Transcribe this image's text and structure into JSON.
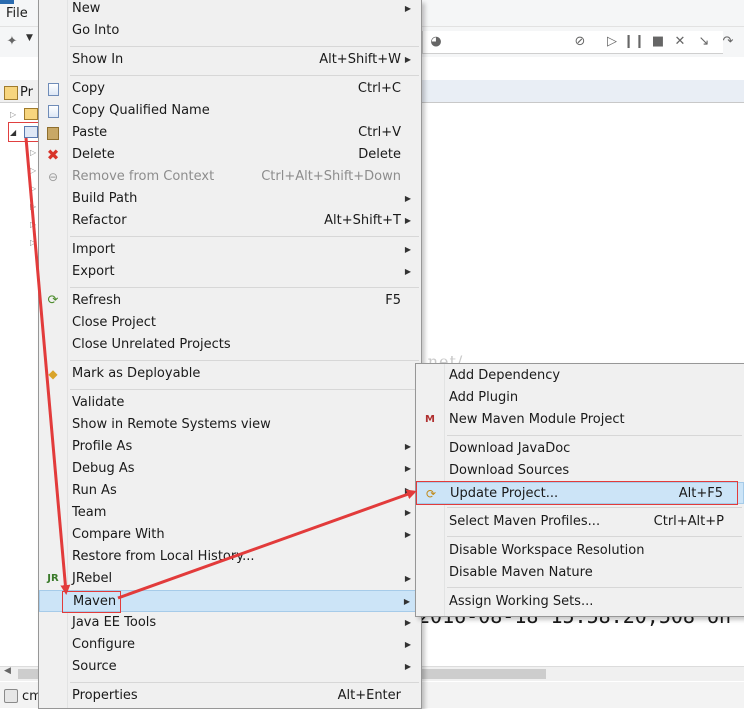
{
  "menubar": {
    "file": "File"
  },
  "explorer": {
    "tab_label": "Pr"
  },
  "status": {
    "label": "cm"
  },
  "watermark": "http://blog.csdn.net/",
  "console": {
    "log_fragment": "2016-08-18 15:58:20,508 on"
  },
  "context_menu": {
    "items": [
      {
        "label": "New",
        "arrow": "▶"
      },
      {
        "label": "Go Into"
      },
      {
        "label": "Show In",
        "shortcut": "Alt+Shift+W",
        "arrow": "▶"
      },
      {
        "label": "Copy",
        "shortcut": "Ctrl+C"
      },
      {
        "label": "Copy Qualified Name"
      },
      {
        "label": "Paste",
        "shortcut": "Ctrl+V"
      },
      {
        "label": "Delete",
        "shortcut": "Delete"
      },
      {
        "label": "Remove from Context",
        "shortcut": "Ctrl+Alt+Shift+Down"
      },
      {
        "label": "Build Path",
        "arrow": "▶"
      },
      {
        "label": "Refactor",
        "shortcut": "Alt+Shift+T",
        "arrow": "▶"
      },
      {
        "label": "Import",
        "arrow": "▶"
      },
      {
        "label": "Export",
        "arrow": "▶"
      },
      {
        "label": "Refresh",
        "shortcut": "F5"
      },
      {
        "label": "Close Project"
      },
      {
        "label": "Close Unrelated Projects"
      },
      {
        "label": "Mark as Deployable"
      },
      {
        "label": "Validate"
      },
      {
        "label": "Show in Remote Systems view"
      },
      {
        "label": "Profile As",
        "arrow": "▶"
      },
      {
        "label": "Debug As",
        "arrow": "▶"
      },
      {
        "label": "Run As",
        "arrow": "▶"
      },
      {
        "label": "Team",
        "arrow": "▶"
      },
      {
        "label": "Compare With",
        "arrow": "▶"
      },
      {
        "label": "Restore from Local History..."
      },
      {
        "label": "JRebel",
        "arrow": "▶"
      },
      {
        "label": "Maven",
        "arrow": "▶"
      },
      {
        "label": "Java EE Tools",
        "arrow": "▶"
      },
      {
        "label": "Configure",
        "arrow": "▶"
      },
      {
        "label": "Source",
        "arrow": "▶"
      },
      {
        "label": "Properties",
        "shortcut": "Alt+Enter"
      }
    ]
  },
  "maven_submenu": {
    "items": [
      {
        "label": "Add Dependency"
      },
      {
        "label": "Add Plugin"
      },
      {
        "label": "New Maven Module Project"
      },
      {
        "label": "Download JavaDoc"
      },
      {
        "label": "Download Sources"
      },
      {
        "label": "Update Project...",
        "shortcut": "Alt+F5"
      },
      {
        "label": "Select Maven Profiles...",
        "shortcut": "Ctrl+Alt+P"
      },
      {
        "label": "Disable Workspace Resolution"
      },
      {
        "label": "Disable Maven Nature"
      },
      {
        "label": "Assign Working Sets..."
      }
    ]
  },
  "colors": {
    "highlight": "#cce4f7",
    "annotation": "#e23b3b",
    "menu_bg": "#f0f0f0"
  }
}
